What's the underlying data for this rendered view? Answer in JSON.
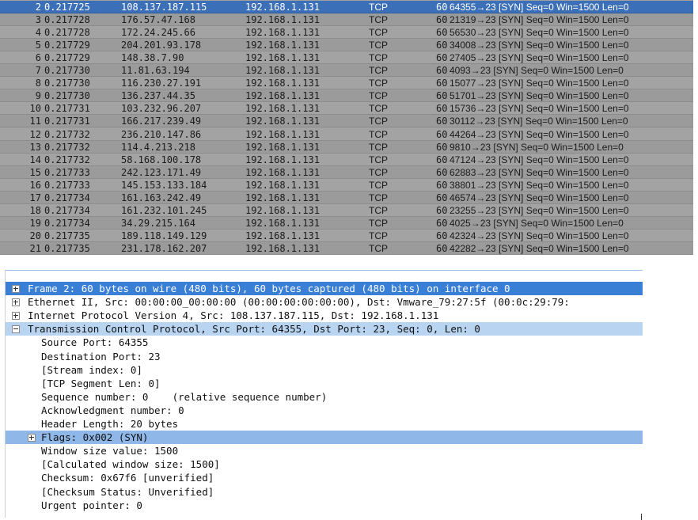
{
  "packet_list": {
    "rows": [
      {
        "no": "2",
        "time": "0.217725",
        "src": "108.137.187.115",
        "dst": "192.168.1.131",
        "proto": "TCP",
        "len": "60",
        "info": "64355→23 [SYN] Seq=0 Win=1500 Len=0"
      },
      {
        "no": "3",
        "time": "0.217728",
        "src": "176.57.47.168",
        "dst": "192.168.1.131",
        "proto": "TCP",
        "len": "60",
        "info": "21319→23 [SYN] Seq=0 Win=1500 Len=0"
      },
      {
        "no": "4",
        "time": "0.217728",
        "src": "172.24.245.66",
        "dst": "192.168.1.131",
        "proto": "TCP",
        "len": "60",
        "info": "56530→23 [SYN] Seq=0 Win=1500 Len=0"
      },
      {
        "no": "5",
        "time": "0.217729",
        "src": "204.201.93.178",
        "dst": "192.168.1.131",
        "proto": "TCP",
        "len": "60",
        "info": "34008→23 [SYN] Seq=0 Win=1500 Len=0"
      },
      {
        "no": "6",
        "time": "0.217729",
        "src": "148.38.7.90",
        "dst": "192.168.1.131",
        "proto": "TCP",
        "len": "60",
        "info": "27405→23 [SYN] Seq=0 Win=1500 Len=0"
      },
      {
        "no": "7",
        "time": "0.217730",
        "src": "11.81.63.194",
        "dst": "192.168.1.131",
        "proto": "TCP",
        "len": "60",
        "info": "4093→23 [SYN] Seq=0 Win=1500 Len=0"
      },
      {
        "no": "8",
        "time": "0.217730",
        "src": "116.230.27.191",
        "dst": "192.168.1.131",
        "proto": "TCP",
        "len": "60",
        "info": "15077→23 [SYN] Seq=0 Win=1500 Len=0"
      },
      {
        "no": "9",
        "time": "0.217730",
        "src": "136.237.44.35",
        "dst": "192.168.1.131",
        "proto": "TCP",
        "len": "60",
        "info": "51701→23 [SYN] Seq=0 Win=1500 Len=0"
      },
      {
        "no": "10",
        "time": "0.217731",
        "src": "103.232.96.207",
        "dst": "192.168.1.131",
        "proto": "TCP",
        "len": "60",
        "info": "15736→23 [SYN] Seq=0 Win=1500 Len=0"
      },
      {
        "no": "11",
        "time": "0.217731",
        "src": "166.217.239.49",
        "dst": "192.168.1.131",
        "proto": "TCP",
        "len": "60",
        "info": "30112→23 [SYN] Seq=0 Win=1500 Len=0"
      },
      {
        "no": "12",
        "time": "0.217732",
        "src": "236.210.147.86",
        "dst": "192.168.1.131",
        "proto": "TCP",
        "len": "60",
        "info": "44264→23 [SYN] Seq=0 Win=1500 Len=0"
      },
      {
        "no": "13",
        "time": "0.217732",
        "src": "114.4.213.218",
        "dst": "192.168.1.131",
        "proto": "TCP",
        "len": "60",
        "info": "9810→23 [SYN] Seq=0 Win=1500 Len=0"
      },
      {
        "no": "14",
        "time": "0.217732",
        "src": "58.168.100.178",
        "dst": "192.168.1.131",
        "proto": "TCP",
        "len": "60",
        "info": "47124→23 [SYN] Seq=0 Win=1500 Len=0"
      },
      {
        "no": "15",
        "time": "0.217733",
        "src": "242.123.171.49",
        "dst": "192.168.1.131",
        "proto": "TCP",
        "len": "60",
        "info": "62883→23 [SYN] Seq=0 Win=1500 Len=0"
      },
      {
        "no": "16",
        "time": "0.217733",
        "src": "145.153.133.184",
        "dst": "192.168.1.131",
        "proto": "TCP",
        "len": "60",
        "info": "38801→23 [SYN] Seq=0 Win=1500 Len=0"
      },
      {
        "no": "17",
        "time": "0.217734",
        "src": "161.163.242.49",
        "dst": "192.168.1.131",
        "proto": "TCP",
        "len": "60",
        "info": "46574→23 [SYN] Seq=0 Win=1500 Len=0"
      },
      {
        "no": "18",
        "time": "0.217734",
        "src": "161.232.101.245",
        "dst": "192.168.1.131",
        "proto": "TCP",
        "len": "60",
        "info": "23255→23 [SYN] Seq=0 Win=1500 Len=0"
      },
      {
        "no": "19",
        "time": "0.217734",
        "src": "34.29.215.164",
        "dst": "192.168.1.131",
        "proto": "TCP",
        "len": "60",
        "info": "4025→23 [SYN] Seq=0 Win=1500 Len=0"
      },
      {
        "no": "20",
        "time": "0.217735",
        "src": "189.118.149.129",
        "dst": "192.168.1.131",
        "proto": "TCP",
        "len": "60",
        "info": "42324→23 [SYN] Seq=0 Win=1500 Len=0"
      },
      {
        "no": "21",
        "time": "0.217735",
        "src": "231.178.162.207",
        "dst": "192.168.1.131",
        "proto": "TCP",
        "len": "60",
        "info": "42282→23 [SYN] Seq=0 Win=1500 Len=0"
      }
    ]
  },
  "details": {
    "lines": [
      {
        "text": "Frame 2: 60 bytes on wire (480 bits), 60 bytes captured (480 bits) on interface 0",
        "expander": "plus",
        "style": "dark",
        "name": "tree-frame"
      },
      {
        "text": "Ethernet II, Src: 00:00:00_00:00:00 (00:00:00:00:00:00), Dst: Vmware_79:27:5f (00:0c:29:79:",
        "expander": "plus",
        "style": "",
        "name": "tree-ethernet"
      },
      {
        "text": "Internet Protocol Version 4, Src: 108.137.187.115, Dst: 192.168.1.131",
        "expander": "plus",
        "style": "",
        "name": "tree-ipv4"
      },
      {
        "text": "Transmission Control Protocol, Src Port: 64355, Dst Port: 23, Seq: 0, Len: 0",
        "expander": "minus",
        "style": "light",
        "name": "tree-tcp"
      },
      {
        "text": "Source Port: 64355",
        "expander": "",
        "style": "",
        "name": "field-source-port"
      },
      {
        "text": "Destination Port: 23",
        "expander": "",
        "style": "",
        "name": "field-destination-port"
      },
      {
        "text": "[Stream index: 0]",
        "expander": "",
        "style": "",
        "name": "field-stream-index"
      },
      {
        "text": "[TCP Segment Len: 0]",
        "expander": "",
        "style": "",
        "name": "field-segment-len"
      },
      {
        "text": "Sequence number: 0    (relative sequence number)",
        "expander": "",
        "style": "",
        "name": "field-sequence-number"
      },
      {
        "text": "Acknowledgment number: 0",
        "expander": "",
        "style": "",
        "name": "field-ack-number"
      },
      {
        "text": "Header Length: 20 bytes",
        "expander": "",
        "style": "",
        "name": "field-header-length"
      },
      {
        "text": "Flags: 0x002 (SYN)",
        "expander": "plus",
        "style": "mid",
        "name": "tree-flags"
      },
      {
        "text": "Window size value: 1500",
        "expander": "",
        "style": "",
        "name": "field-window-size"
      },
      {
        "text": "[Calculated window size: 1500]",
        "expander": "",
        "style": "",
        "name": "field-calc-window-size"
      },
      {
        "text": "Checksum: 0x67f6 [unverified]",
        "expander": "",
        "style": "",
        "name": "field-checksum"
      },
      {
        "text": "[Checksum Status: Unverified]",
        "expander": "",
        "style": "",
        "name": "field-checksum-status"
      },
      {
        "text": "Urgent pointer: 0",
        "expander": "",
        "style": "",
        "name": "field-urgent-pointer"
      }
    ]
  },
  "colors": {
    "selected_row": "#3b6fb8",
    "row_gray": "#a3a3a3",
    "detail_highlight_dark": "#3a7fd6",
    "detail_highlight_light": "#b8d4f0",
    "detail_highlight_mid": "#8fb8e8"
  }
}
